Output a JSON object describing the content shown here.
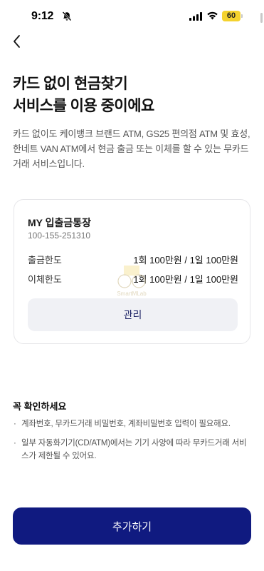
{
  "status_bar": {
    "time": "9:12",
    "battery": "60",
    "icons": [
      "bell-slash-icon",
      "signal-icon",
      "wifi-icon",
      "battery-icon"
    ]
  },
  "nav": {
    "back_icon": "chevron-left-icon"
  },
  "title": {
    "line1": "카드 없이 현금찾기",
    "line2": "서비스를 이용 중이에요"
  },
  "description": "카드 없이도 케이뱅크 브랜드 ATM, GS25 편의점 ATM 및 효성, 한네트 VAN ATM에서 현금 출금 또는 이체를 할 수 있는 무카드거래 서비스입니다.",
  "account": {
    "name": "MY 입출금통장",
    "number": "100-155-251310",
    "limits": [
      {
        "label": "출금한도",
        "value": "1회 100만원 / 1일 100만원"
      },
      {
        "label": "이체한도",
        "value": "1회 100만원 / 1일 100만원"
      }
    ],
    "manage_label": "관리"
  },
  "watermark": {
    "text": "SmartMLab"
  },
  "notice": {
    "title": "꼭 확인하세요",
    "items": [
      "계좌번호, 무카드거래 비밀번호, 계좌비밀번호 입력이 필요해요.",
      "일부 자동화기기(CD/ATM)에서는 기기 사양에 따라 무카드거래 서비스가 제한될 수 있어요."
    ]
  },
  "cta": {
    "label": "추가하기"
  },
  "colors": {
    "primary": "#101a80",
    "manage_button_bg": "#f0f1f5",
    "manage_button_text": "#1e2466",
    "battery": "#f4d22e"
  }
}
